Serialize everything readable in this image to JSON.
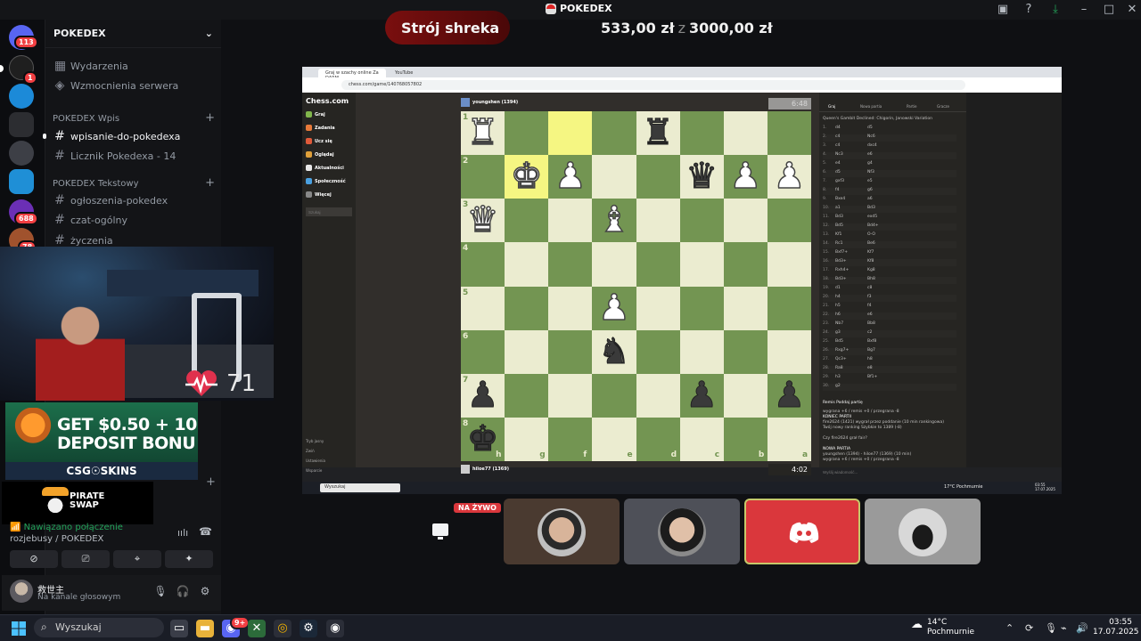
{
  "window": {
    "title": "POKEDEX"
  },
  "rail": {
    "servers": [
      {
        "badge": "113"
      },
      {
        "badge": "1"
      },
      {
        "badge": ""
      },
      {
        "badge": ""
      },
      {
        "badge": ""
      },
      {
        "badge": ""
      },
      {
        "badge": "688"
      },
      {
        "badge": "78"
      }
    ]
  },
  "sidebar": {
    "server_name": "POKEDEX",
    "events": "Wydarzenia",
    "boosts": "Wzmocnienia serwera",
    "category1": "POKEDEX Wpis",
    "category2": "POKEDEX Tekstowy",
    "channels": [
      "wpisanie-do-pokedexa",
      "Licznik Pokedexa - 14",
      "ogłoszenia-pokedex",
      "czat-ogólny",
      "życzenia"
    ]
  },
  "overlay": {
    "heart_rate": "71",
    "ad_line1": "GET $0.50 + 10",
    "ad_line2": "DEPOSIT BONU",
    "ad_brand": "CSG☉SKINS",
    "pirate_line1": "PIRATE",
    "pirate_line2": "SWAP"
  },
  "voice": {
    "status": "Nawiązano połączenie",
    "location": "rozjebusy / POKEDEX"
  },
  "user": {
    "name": "救世主",
    "status": "Na kanale głosowym"
  },
  "stream": {
    "goal_name": "Strój shreka",
    "goal_current": "533,00 zł",
    "goal_sep": "z",
    "goal_target": "3000,00 zł",
    "live_label": "NA ŻYWO"
  },
  "browser": {
    "tab1": "Graj w szachy online Za DARM...",
    "tab2": "YouTube",
    "url": "chess.com/game/140768057802"
  },
  "chess": {
    "logo": "Chess.com",
    "nav": [
      "Graj",
      "Zadania",
      "Ucz się",
      "Oglądaj",
      "Aktualności",
      "Społeczność",
      "Więcej"
    ],
    "search_placeholder": "Szukaj",
    "footer": [
      "Tryb jasny",
      "Zwiń",
      "Ustawienia",
      "Wsparcie"
    ],
    "top_player": "youngshen (1394)",
    "bottom_player": "hiloe77 (1369)",
    "top_clock": "6:48",
    "bottom_clock": "4:02",
    "opening": "Queen's Gambit Declined: Chigorin, Janowski Variation",
    "files": [
      "h",
      "g",
      "f",
      "e",
      "d",
      "c",
      "b",
      "a"
    ],
    "ranks": [
      "1",
      "2",
      "3",
      "4",
      "5",
      "6",
      "7",
      "8"
    ],
    "moves": [
      [
        "1.",
        "d4",
        "d5"
      ],
      [
        "2.",
        "c4",
        "Nc6"
      ],
      [
        "3.",
        "c4",
        "dxc4"
      ],
      [
        "4.",
        "Nc3",
        "e6"
      ],
      [
        "5.",
        "e4",
        "g4"
      ],
      [
        "6.",
        "d5",
        "Nf3"
      ],
      [
        "7.",
        "gxf3",
        "e5"
      ],
      [
        "8.",
        "f4",
        "g6"
      ],
      [
        "9.",
        "Bxe4",
        "a6"
      ],
      [
        "10.",
        "a1",
        "Bd3"
      ],
      [
        "11.",
        "Bd3",
        "exd5"
      ],
      [
        "12.",
        "Bd5",
        "Bd4+"
      ],
      [
        "13.",
        "Kf1",
        "O-O"
      ],
      [
        "14.",
        "Rc1",
        "Be6"
      ],
      [
        "15.",
        "Bxf7+",
        "Kf7"
      ],
      [
        "16.",
        "Bd3+",
        "Kf8"
      ],
      [
        "17.",
        "Rxh4+",
        "Kg8"
      ],
      [
        "18.",
        "Bd3+",
        "Bh8"
      ],
      [
        "19.",
        "d1",
        "c8"
      ],
      [
        "20.",
        "h4",
        "f3"
      ],
      [
        "21.",
        "h5",
        "f4"
      ],
      [
        "22.",
        "h6",
        "e6"
      ],
      [
        "23.",
        "Nb7",
        "Bb8"
      ],
      [
        "24.",
        "g3",
        "c2"
      ],
      [
        "25.",
        "Bd5",
        "Bxf8"
      ],
      [
        "26.",
        "Rxg7+",
        "Bg7"
      ],
      [
        "27.",
        "Qc3+",
        "h8"
      ],
      [
        "28.",
        "Ra8",
        "e8"
      ],
      [
        "29.",
        "h3",
        "Bf1+"
      ],
      [
        "30.",
        "g2",
        ""
      ]
    ],
    "chat_controls": "Remis  Poddaj partię",
    "chat": [
      "wygrana +6 / remis +0 / przegrana -8",
      "KONIEC PARTII",
      "fire2624 (1421) wygrał przez poddanie (10 min rankingowa)",
      "Twój nowy ranking Szybkie to 1389 (-8)",
      "",
      "Czy fire2624 grał fair?",
      "",
      "NOWA PARTIA",
      "youngshen (1394) - hiloe77 (1369) (10 min)",
      "wygrana +6 / remis +0 / przegrana -8"
    ],
    "chat_placeholder": "Wyślij wiadomość...",
    "right_tabs": [
      "Graj",
      "Nowa partia",
      "Partie",
      "Gracze"
    ],
    "mini_search": "Wyszukaj",
    "mini_weather": "17°C Pochmurnie",
    "mini_time": "03:55",
    "mini_date": "17.07.2025"
  },
  "taskbar": {
    "search": "Wyszukaj",
    "weather_temp": "14°C",
    "weather_desc": "Pochmurnie",
    "time": "03:55",
    "date": "17.07.2025",
    "discord_badge": "9+"
  }
}
